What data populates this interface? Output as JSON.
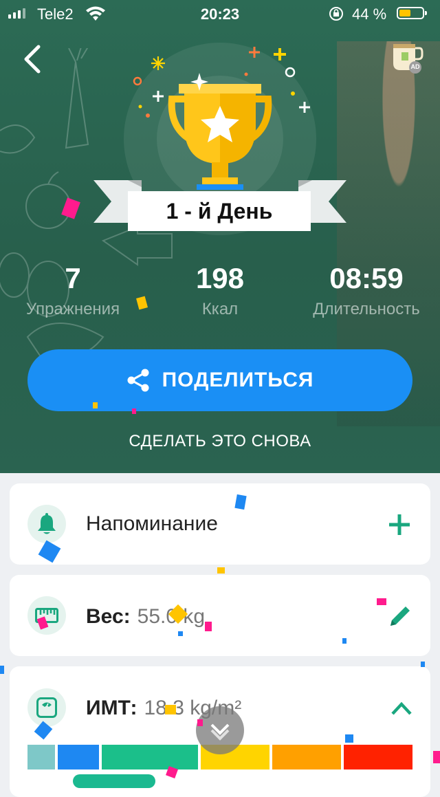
{
  "status_bar": {
    "carrier": "Tele2",
    "time": "20:23",
    "battery": "44 %"
  },
  "result": {
    "day_label": "1 - й День",
    "stats": [
      {
        "value": "7",
        "label": "Упражнения"
      },
      {
        "value": "198",
        "label": "Ккал"
      },
      {
        "value": "08:59",
        "label": "Длительность"
      }
    ],
    "share_label": "ПОДЕЛИТЬСЯ",
    "again_label": "СДЕЛАТЬ ЭТО СНОВА"
  },
  "ad_badge": "AD",
  "cards": {
    "reminder": {
      "label": "Напоминание"
    },
    "weight": {
      "label": "Вес:",
      "value": "55.0 kg"
    },
    "bmi": {
      "label": "ИМТ:",
      "value": "18.3 kg/m²"
    }
  },
  "bmi_scale_colors": [
    "#7ec8c8",
    "#1e88f2",
    "#1bbf8a",
    "#ffd400",
    "#ffa000",
    "#ff2200"
  ],
  "colors": {
    "accent_green": "#1aa77f",
    "share_blue": "#1a8ff5",
    "hero_green": "#2c6b55"
  }
}
